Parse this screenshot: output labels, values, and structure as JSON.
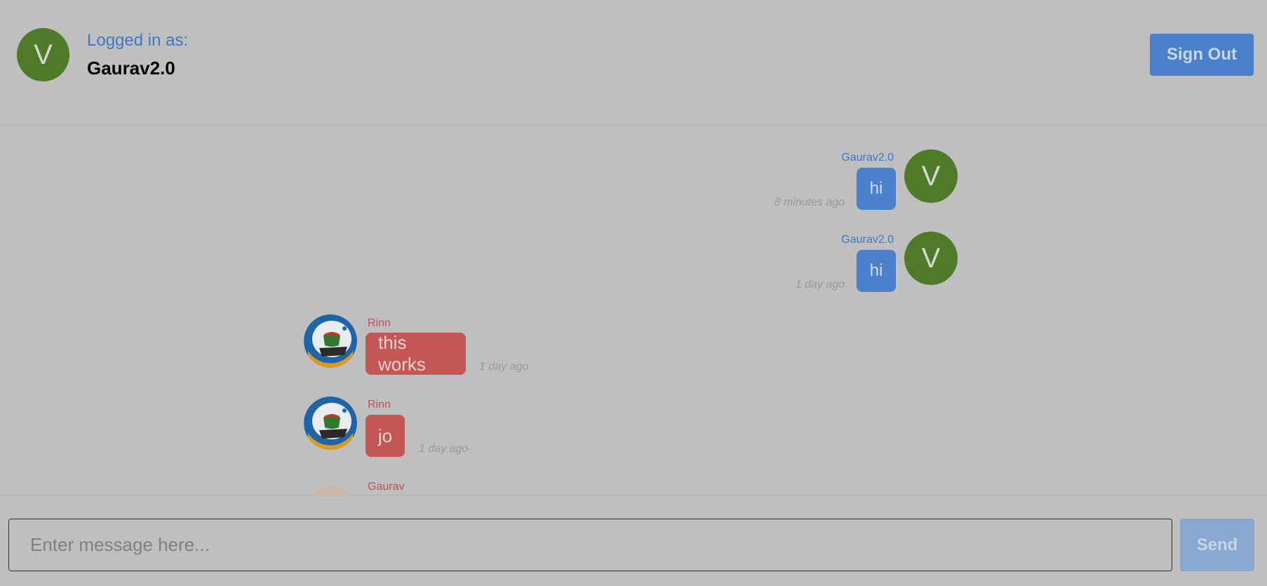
{
  "header": {
    "avatar_letter": "V",
    "logged_label": "Logged in as:",
    "username": "Gaurav2.0",
    "signout_label": "Sign Out"
  },
  "messages": [
    {
      "sender": "Gaurav2.0",
      "text": "hi",
      "time": "8 minutes ago",
      "side": "right",
      "avatar": "V"
    },
    {
      "sender": "Gaurav2.0",
      "text": "hi",
      "time": "1 day ago",
      "side": "right",
      "avatar": "V"
    },
    {
      "sender": "Rinn",
      "text": "this works",
      "time": "1 day ago",
      "side": "left",
      "avatar": "helmet-avatar-icon"
    },
    {
      "sender": "Rinn",
      "text": "jo",
      "time": "1 day ago",
      "side": "left",
      "avatar": "helmet-avatar-icon"
    },
    {
      "sender": "Gaurav",
      "text": "",
      "time": "",
      "side": "left",
      "avatar": "person-avatar-icon"
    }
  ],
  "composer": {
    "placeholder": "Enter message here...",
    "send_label": "Send"
  },
  "colors": {
    "background": "#bfbfbf",
    "accent_blue": "#4a80cc",
    "accent_red": "#c45656",
    "avatar_green": "#4f7a28"
  }
}
